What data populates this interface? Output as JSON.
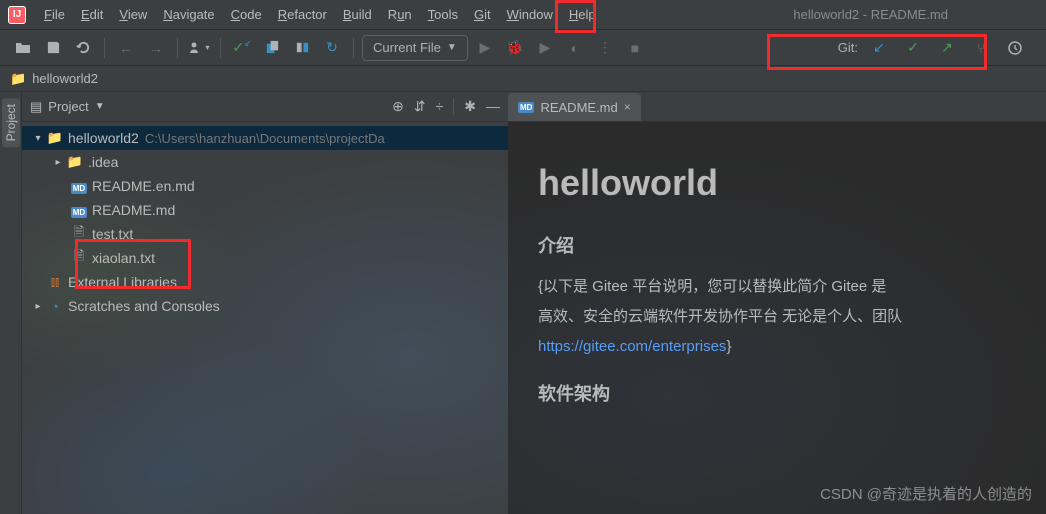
{
  "window_title": "helloworld2 - README.md",
  "menu": [
    "File",
    "Edit",
    "View",
    "Navigate",
    "Code",
    "Refactor",
    "Build",
    "Run",
    "Tools",
    "Git",
    "Window",
    "Help"
  ],
  "run_config": "Current File",
  "git_label": "Git:",
  "breadcrumb": "helloworld2",
  "side_tab": "Project",
  "panel_title": "Project",
  "tree": {
    "root": "helloworld2",
    "root_path": "C:\\Users\\hanzhuan\\Documents\\projectDa",
    "idea": ".idea",
    "readme_en": "README.en.md",
    "readme": "README.md",
    "test": "test.txt",
    "xiaolan": "xiaolan.txt",
    "ext_lib": "External Libraries",
    "scratches": "Scratches and Consoles"
  },
  "tab": "README.md",
  "doc": {
    "h1": "helloworld",
    "intro_h": "介绍",
    "intro_p1": "{以下是 Gitee 平台说明，您可以替换此简介 Gitee 是",
    "intro_p2": "高效、安全的云端软件开发协作平台 无论是个人、团队",
    "intro_link": "https://gitee.com/enterprises",
    "intro_p3": "}",
    "arch_h": "软件架构"
  },
  "watermark": "CSDN @奇迹是执着的人创造的"
}
